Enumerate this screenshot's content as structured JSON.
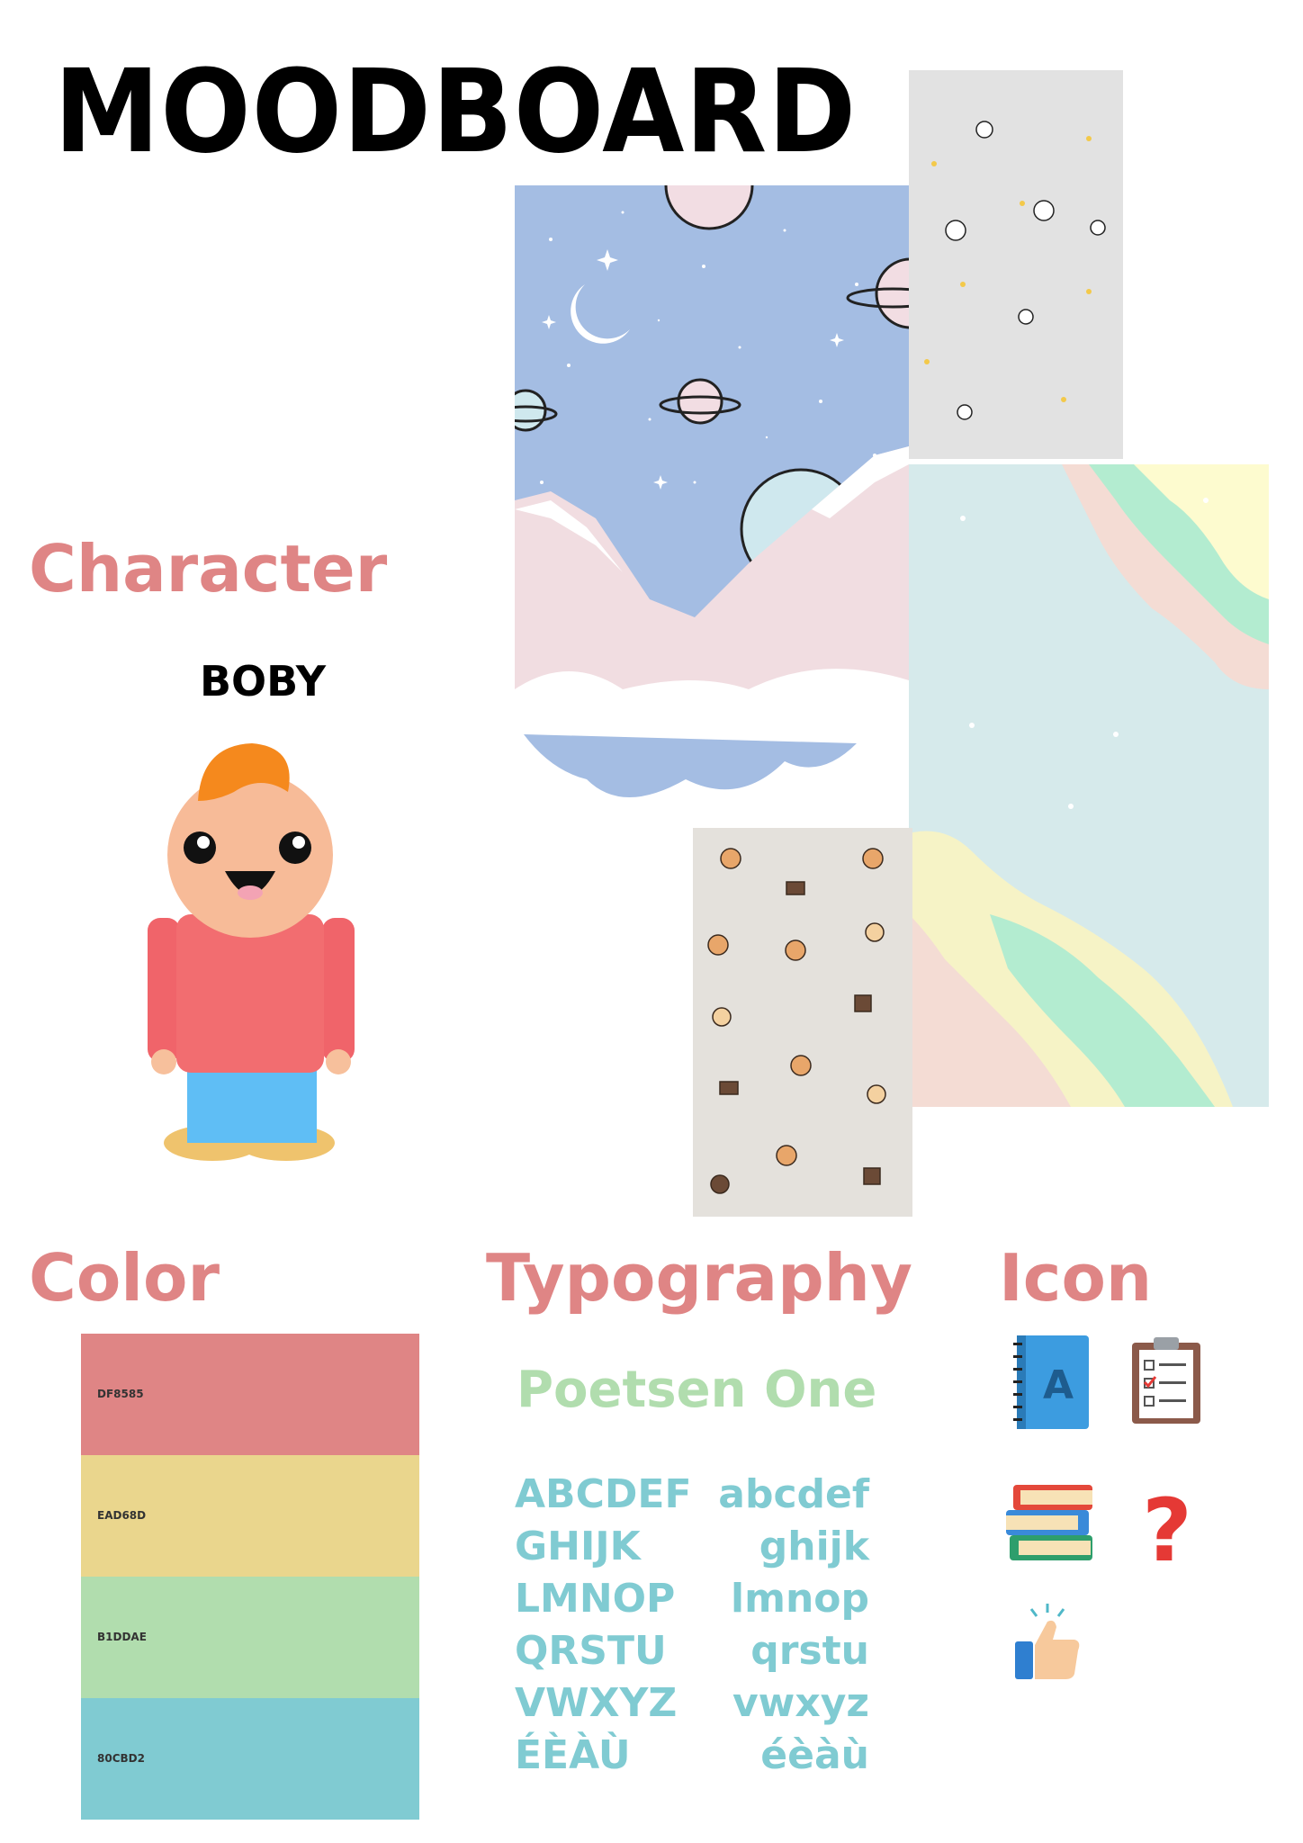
{
  "title": "MOODBOARD",
  "character": {
    "heading": "Character",
    "name": "BOBY"
  },
  "color": {
    "heading": "Color",
    "swatches": [
      {
        "hex_label": "DF8585",
        "color": "#df8585"
      },
      {
        "hex_label": "EAD68D",
        "color": "#ead68d"
      },
      {
        "hex_label": "B1DDAE",
        "color": "#b1ddae"
      },
      {
        "hex_label": "80CBD2",
        "color": "#80cbd2"
      }
    ]
  },
  "typography": {
    "heading": "Typography",
    "font_name": "Poetsen One",
    "uppercase": [
      "ABCDEF",
      "GHIJK",
      "LMNOP",
      "QRSTU",
      "VWXYZ",
      "ÉÈÀÙ"
    ],
    "lowercase": [
      "abcdef",
      "ghijk",
      "lmnop",
      "qrstu",
      "vwxyz",
      "éèàù"
    ]
  },
  "icon": {
    "heading": "Icon",
    "items": [
      "notebook-icon",
      "clipboard-checklist-icon",
      "books-icon",
      "question-mark-icon",
      "thumbs-up-icon"
    ],
    "notebook_letter": "A",
    "question_mark": "?"
  },
  "colors": {
    "heading": "#df8585",
    "font_name": "#b1ddae",
    "glyphs": "#80cbd2"
  }
}
